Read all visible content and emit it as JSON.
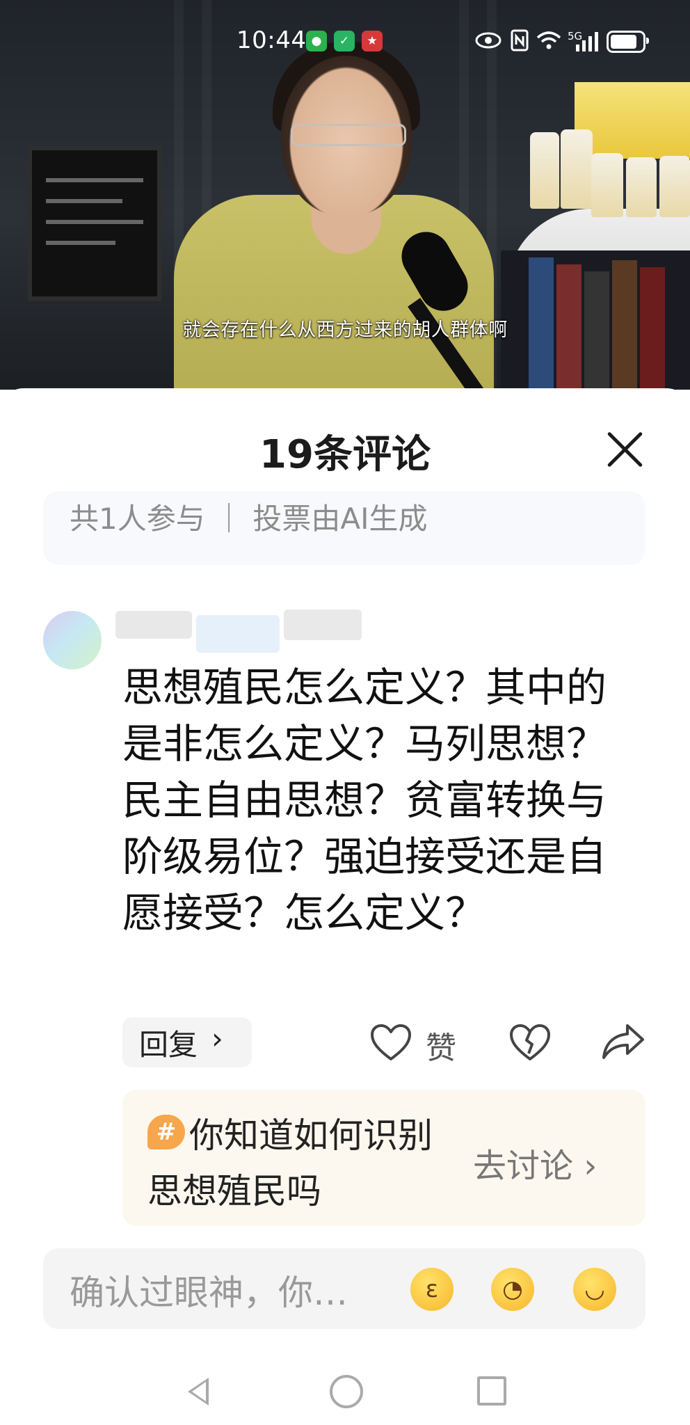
{
  "status_bar": {
    "time": "10:44",
    "icons_left": [
      "wechat-icon",
      "shield-app-icon",
      "news-app-icon"
    ],
    "network": "5G",
    "icons_right": [
      "eye-icon",
      "nfc-icon",
      "wifi-icon",
      "signal-icon",
      "battery-icon"
    ]
  },
  "video": {
    "subtitle": "就会存在什么从西方过来的胡人群体啊"
  },
  "comments_panel": {
    "title": "19条评论",
    "vote_summary": "共1人参与 ｜ 投票由AI生成"
  },
  "comment": {
    "text": "思想殖民怎么定义？其中的是非怎么定义？马列思想？民主自由思想？贫富转换与阶级易位？强迫接受还是自愿接受？怎么定义？",
    "reply_label": "回复",
    "like_label": "赞"
  },
  "topic": {
    "hash_symbol": "#",
    "text": "你知道如何识别思想殖民吗",
    "action_label": "去讨论"
  },
  "input": {
    "placeholder": "确认过眼神，你…",
    "emojis": [
      "blowing-kiss-emoji",
      "sparkle-smirk-emoji",
      "smiling-emoji"
    ]
  },
  "nav": [
    "back-icon",
    "home-icon",
    "recents-icon"
  ]
}
